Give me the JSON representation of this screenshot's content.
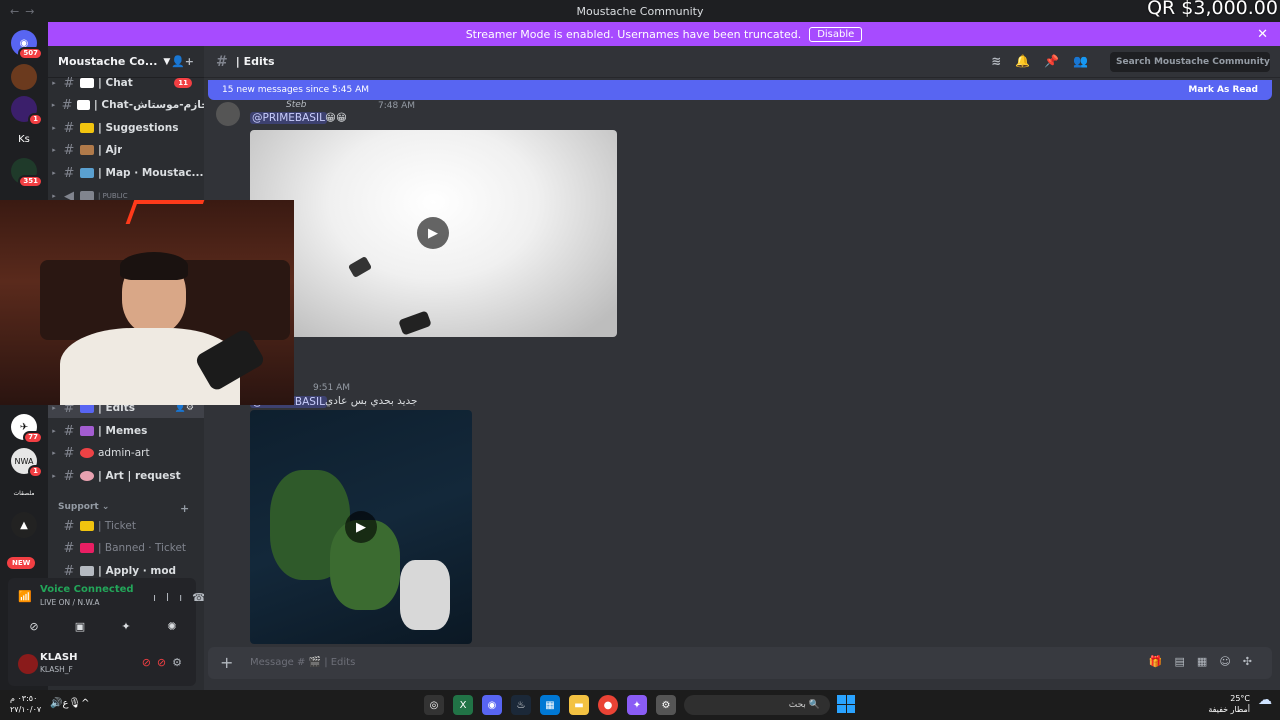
{
  "window": {
    "title": "Moustache Community",
    "overlay_text": "QR $3,000.00"
  },
  "banner": {
    "text": "Streamer Mode is enabled. Usernames have been truncated.",
    "button": "Disable"
  },
  "rail": {
    "badges": [
      "507",
      "1",
      "351",
      "77",
      "1"
    ],
    "ks_label": "Ks",
    "arabic_label": "ملصقات",
    "new_label": "NEW"
  },
  "sidebar": {
    "server_name": "Moustache Co...",
    "channels": [
      {
        "label": "| Chat",
        "count": "11",
        "color": "#ffffff"
      },
      {
        "label": "| Chat-محازم-موستاش",
        "count": "",
        "color": "#ffffff"
      },
      {
        "label": "| Suggestions",
        "count": "",
        "color": "#f1c40f"
      },
      {
        "label": "| Ajr",
        "count": "",
        "color": "#b07a4a"
      },
      {
        "label": "| Map · Moustac...",
        "count": "",
        "color": "#5aa0d0"
      },
      {
        "label": "| PUBLIC",
        "count": "",
        "color": "#80848e"
      }
    ],
    "channels_lower": [
      {
        "label": "| Edits",
        "color": "#5865f2"
      },
      {
        "label": "| Memes",
        "color": "#a35dd1"
      },
      {
        "label": "admin-art",
        "color": "#ed4245"
      },
      {
        "label": "| Art | request",
        "color": "#e8a1b0"
      }
    ],
    "support_category": "Support",
    "support_channels": [
      {
        "label": "| Ticket",
        "color": "#f1c40f"
      },
      {
        "label": "| Banned · Ticket",
        "color": "#e91e63"
      },
      {
        "label": "| Apply · mod",
        "color": "#b5bac1"
      }
    ]
  },
  "voice": {
    "status": "Voice Connected",
    "channel": "LIVE ON / N.W.A"
  },
  "user": {
    "name": "KLASH",
    "tag": "KLASH_F"
  },
  "main": {
    "channel_name": "| Edits",
    "search_placeholder": "Search Moustache Community",
    "new_messages": "15 new messages since 5:45 AM",
    "mark_as_read": "Mark As Read",
    "msg1": {
      "author": "Steb",
      "time": "7:48 AM",
      "mention": "@PRIMEBASIL",
      "emoji": "😁😁"
    },
    "msg2": {
      "time": "9:51 AM",
      "mention": "@PRIMEBASIL",
      "text": "جديد بحدي بس عادي"
    },
    "composer_placeholder": "Message # 🎬 | Edits"
  },
  "taskbar": {
    "time": "٠٣:٥٠ م",
    "date": "٢٧/١٠/٠٧",
    "lang": "ع",
    "search_text": "بحث",
    "weather_temp": "25°C",
    "weather_desc": "أمطار خفيفة"
  }
}
